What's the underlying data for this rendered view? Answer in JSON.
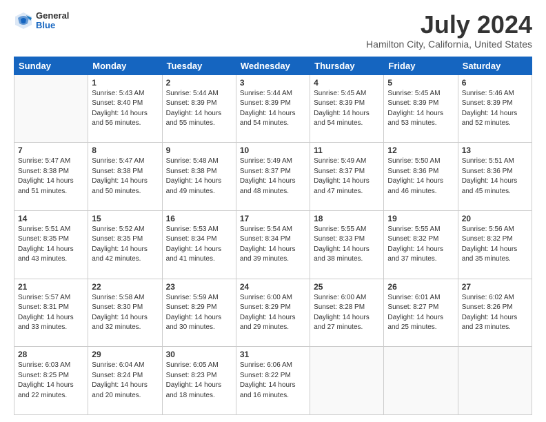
{
  "header": {
    "logo_general": "General",
    "logo_blue": "Blue",
    "main_title": "July 2024",
    "subtitle": "Hamilton City, California, United States"
  },
  "calendar": {
    "days_of_week": [
      "Sunday",
      "Monday",
      "Tuesday",
      "Wednesday",
      "Thursday",
      "Friday",
      "Saturday"
    ],
    "weeks": [
      [
        {
          "day": "",
          "info": ""
        },
        {
          "day": "1",
          "info": "Sunrise: 5:43 AM\nSunset: 8:40 PM\nDaylight: 14 hours\nand 56 minutes."
        },
        {
          "day": "2",
          "info": "Sunrise: 5:44 AM\nSunset: 8:39 PM\nDaylight: 14 hours\nand 55 minutes."
        },
        {
          "day": "3",
          "info": "Sunrise: 5:44 AM\nSunset: 8:39 PM\nDaylight: 14 hours\nand 54 minutes."
        },
        {
          "day": "4",
          "info": "Sunrise: 5:45 AM\nSunset: 8:39 PM\nDaylight: 14 hours\nand 54 minutes."
        },
        {
          "day": "5",
          "info": "Sunrise: 5:45 AM\nSunset: 8:39 PM\nDaylight: 14 hours\nand 53 minutes."
        },
        {
          "day": "6",
          "info": "Sunrise: 5:46 AM\nSunset: 8:39 PM\nDaylight: 14 hours\nand 52 minutes."
        }
      ],
      [
        {
          "day": "7",
          "info": "Sunrise: 5:47 AM\nSunset: 8:38 PM\nDaylight: 14 hours\nand 51 minutes."
        },
        {
          "day": "8",
          "info": "Sunrise: 5:47 AM\nSunset: 8:38 PM\nDaylight: 14 hours\nand 50 minutes."
        },
        {
          "day": "9",
          "info": "Sunrise: 5:48 AM\nSunset: 8:38 PM\nDaylight: 14 hours\nand 49 minutes."
        },
        {
          "day": "10",
          "info": "Sunrise: 5:49 AM\nSunset: 8:37 PM\nDaylight: 14 hours\nand 48 minutes."
        },
        {
          "day": "11",
          "info": "Sunrise: 5:49 AM\nSunset: 8:37 PM\nDaylight: 14 hours\nand 47 minutes."
        },
        {
          "day": "12",
          "info": "Sunrise: 5:50 AM\nSunset: 8:36 PM\nDaylight: 14 hours\nand 46 minutes."
        },
        {
          "day": "13",
          "info": "Sunrise: 5:51 AM\nSunset: 8:36 PM\nDaylight: 14 hours\nand 45 minutes."
        }
      ],
      [
        {
          "day": "14",
          "info": "Sunrise: 5:51 AM\nSunset: 8:35 PM\nDaylight: 14 hours\nand 43 minutes."
        },
        {
          "day": "15",
          "info": "Sunrise: 5:52 AM\nSunset: 8:35 PM\nDaylight: 14 hours\nand 42 minutes."
        },
        {
          "day": "16",
          "info": "Sunrise: 5:53 AM\nSunset: 8:34 PM\nDaylight: 14 hours\nand 41 minutes."
        },
        {
          "day": "17",
          "info": "Sunrise: 5:54 AM\nSunset: 8:34 PM\nDaylight: 14 hours\nand 39 minutes."
        },
        {
          "day": "18",
          "info": "Sunrise: 5:55 AM\nSunset: 8:33 PM\nDaylight: 14 hours\nand 38 minutes."
        },
        {
          "day": "19",
          "info": "Sunrise: 5:55 AM\nSunset: 8:32 PM\nDaylight: 14 hours\nand 37 minutes."
        },
        {
          "day": "20",
          "info": "Sunrise: 5:56 AM\nSunset: 8:32 PM\nDaylight: 14 hours\nand 35 minutes."
        }
      ],
      [
        {
          "day": "21",
          "info": "Sunrise: 5:57 AM\nSunset: 8:31 PM\nDaylight: 14 hours\nand 33 minutes."
        },
        {
          "day": "22",
          "info": "Sunrise: 5:58 AM\nSunset: 8:30 PM\nDaylight: 14 hours\nand 32 minutes."
        },
        {
          "day": "23",
          "info": "Sunrise: 5:59 AM\nSunset: 8:29 PM\nDaylight: 14 hours\nand 30 minutes."
        },
        {
          "day": "24",
          "info": "Sunrise: 6:00 AM\nSunset: 8:29 PM\nDaylight: 14 hours\nand 29 minutes."
        },
        {
          "day": "25",
          "info": "Sunrise: 6:00 AM\nSunset: 8:28 PM\nDaylight: 14 hours\nand 27 minutes."
        },
        {
          "day": "26",
          "info": "Sunrise: 6:01 AM\nSunset: 8:27 PM\nDaylight: 14 hours\nand 25 minutes."
        },
        {
          "day": "27",
          "info": "Sunrise: 6:02 AM\nSunset: 8:26 PM\nDaylight: 14 hours\nand 23 minutes."
        }
      ],
      [
        {
          "day": "28",
          "info": "Sunrise: 6:03 AM\nSunset: 8:25 PM\nDaylight: 14 hours\nand 22 minutes."
        },
        {
          "day": "29",
          "info": "Sunrise: 6:04 AM\nSunset: 8:24 PM\nDaylight: 14 hours\nand 20 minutes."
        },
        {
          "day": "30",
          "info": "Sunrise: 6:05 AM\nSunset: 8:23 PM\nDaylight: 14 hours\nand 18 minutes."
        },
        {
          "day": "31",
          "info": "Sunrise: 6:06 AM\nSunset: 8:22 PM\nDaylight: 14 hours\nand 16 minutes."
        },
        {
          "day": "",
          "info": ""
        },
        {
          "day": "",
          "info": ""
        },
        {
          "day": "",
          "info": ""
        }
      ]
    ]
  }
}
